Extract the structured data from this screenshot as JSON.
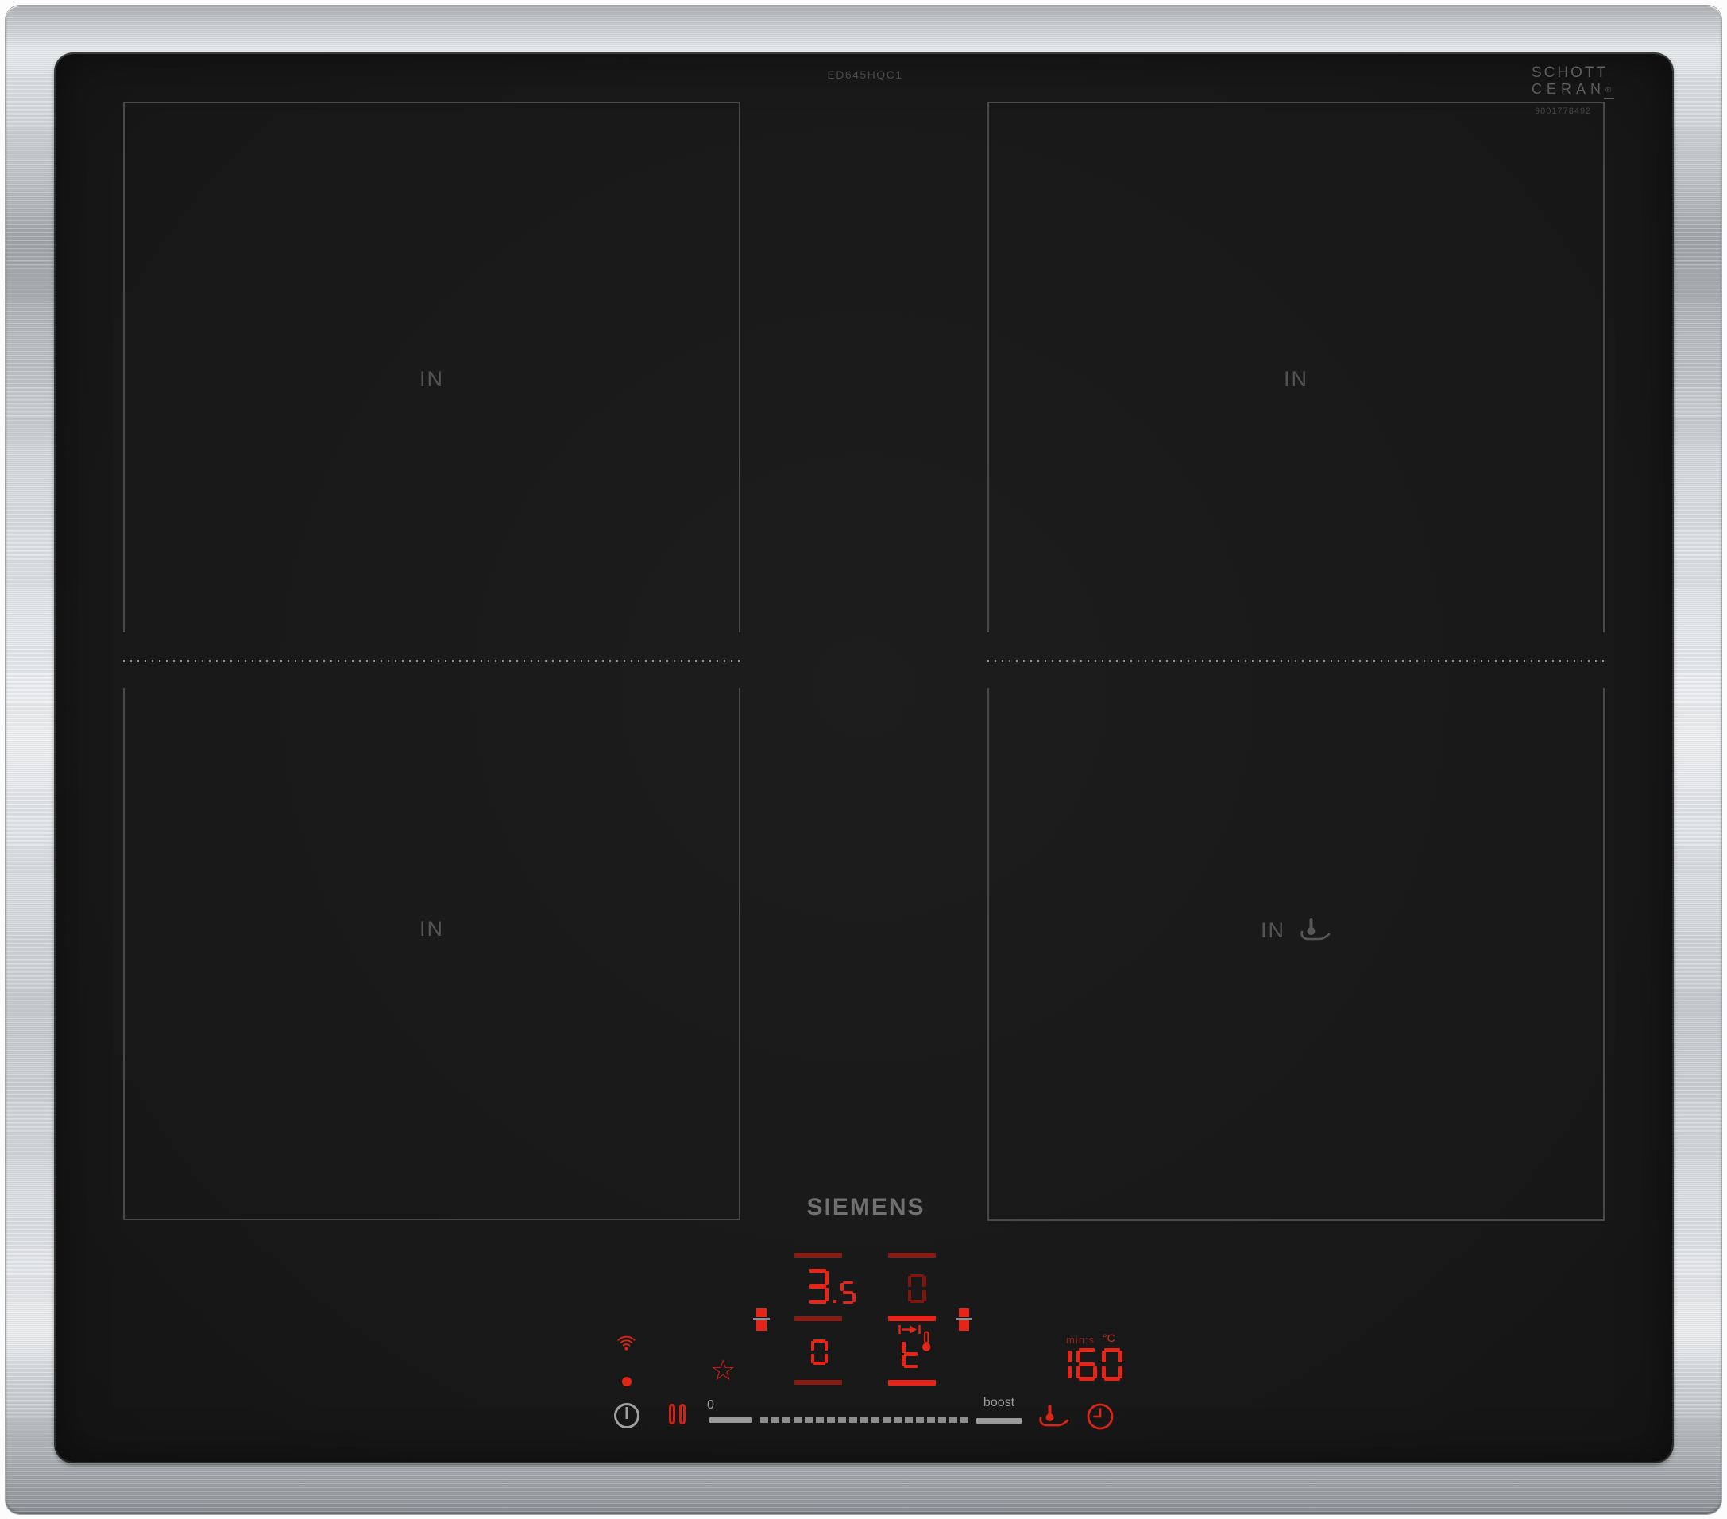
{
  "colors": {
    "led_bright": "#e42517",
    "led_dim": "#7e150f",
    "control_gray": "#9b9b9b",
    "zone_line_gray": "#4a4a4a",
    "print_gray": "#5d5d5d",
    "glass_black": "#1b1b1b",
    "steel": "#dfe2e5"
  },
  "branding": {
    "model_number": "ED645HQC1",
    "logo": "SIEMENS",
    "glass_brand": {
      "line1": "SCHOTT",
      "line2": "CERAN",
      "registered_mark": "®",
      "code": "9001778492"
    }
  },
  "zones": {
    "top_left_label": "IN",
    "top_right_label": "IN",
    "bottom_left_label": "IN",
    "bottom_right_label": "IN"
  },
  "control_panel": {
    "left_zone_display": {
      "power_level": "3.5",
      "secondary_value": "0"
    },
    "right_zone_display": {
      "power_level": "0",
      "function_indicator": "t"
    },
    "timer_display": {
      "value": "160",
      "time_unit": "min:s",
      "temp_unit": "°C"
    },
    "power_slider": {
      "min_label": "0",
      "max_label": "boost"
    },
    "icons": {
      "wifi_icon": "wifi-signal-arcs",
      "status_led": "filled-dot",
      "power_icon": "standby-circle-with-line",
      "pause_icon": "double-vertical-bars",
      "favorite_icon": "☆",
      "zone_select_cursor": "stacked-red-squares-handle",
      "heat_transfer_icon": "arrow-between-end-bars",
      "thermometer_icon": "thermometer",
      "fry_sensor_icon": "pan-with-thermometer",
      "timer_icon": "clock"
    }
  }
}
